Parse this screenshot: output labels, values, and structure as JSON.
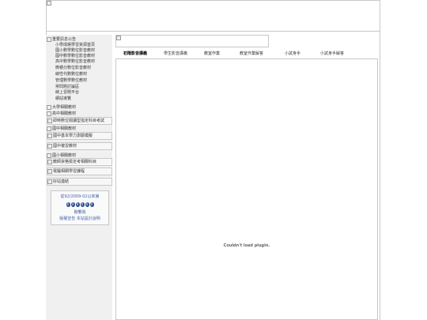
{
  "sidebar": {
    "announce": "重要訊息公告",
    "links": [
      "小學成績學習資源首頁",
      "國小數學數位影音教材",
      "國中數學數位影音教材",
      "高中數學數位影音教材",
      "微積分數位影音教材",
      "線性代數數位教材",
      "管理數學數位教材",
      "常問題討論區",
      "線上習題平台",
      "網站導覽"
    ],
    "rows": [
      "大學相關教材",
      "高中相關教材",
      "即時數位閱讀型指定科目考試",
      "國中相關教材",
      "國中基本學力測驗模擬",
      "國中複習教材",
      "國小相關教材",
      "教師資格檢定考相關科目",
      "電腦相關學習課程",
      "好站連結"
    ],
    "counter": {
      "since": "從92/2009-02以來第",
      "digits": [
        "0",
        "4",
        "9",
        "0",
        "0",
        "0"
      ],
      "link1": "聯繫我",
      "link2": "版權宣告 本站設計說明"
    }
  },
  "tabs": [
    "初階影音講義",
    "學生影音講義",
    "教室作業",
    "教室作業解答",
    "小試身手",
    "小試身手解答"
  ],
  "plugin_message": "Couldn't load plugin."
}
